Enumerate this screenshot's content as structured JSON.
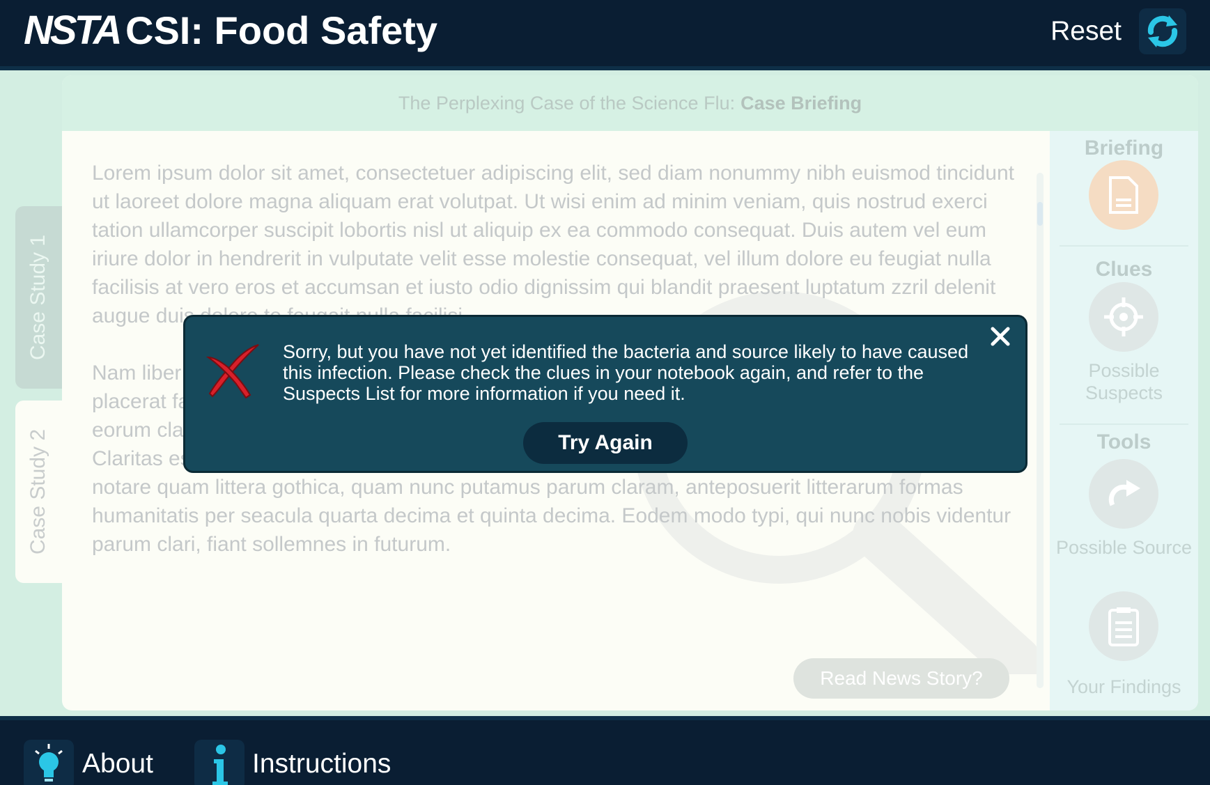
{
  "header": {
    "logo": "NSTA",
    "title": "CSI: Food Safety",
    "reset_label": "Reset"
  },
  "tabs": [
    {
      "label": "Case Study 1"
    },
    {
      "label": "Case Study 2"
    }
  ],
  "panel": {
    "header_prefix": "The Perplexing Case of the Science Flu:",
    "header_bold": "Case Briefing",
    "paragraphs": [
      "Lorem ipsum dolor sit amet, consectetuer adipiscing elit, sed diam nonummy nibh euismod tincidunt ut laoreet dolore magna aliquam erat volutpat. Ut wisi enim ad minim veniam, quis nostrud exerci tation ullamcorper suscipit lobortis nisl ut aliquip ex ea commodo consequat. Duis autem vel eum iriure dolor in hendrerit in vulputate velit esse molestie consequat, vel illum dolore eu feugiat nulla facilisis at vero eros et accumsan et iusto odio dignissim qui blandit praesent luptatum zzril delenit augue duis dolore te feugait nulla facilisi.",
      "Nam liber tempor cum soluta nobis eleifend option congue nihil imperdiet doming id quod mazim placerat facer possim assum. Typi non habent claritatem insitam; est usus legentis in iis qui facit eorum claritatem. Investigationes demonstraverunt lectores legere me lius quod ii legunt saepius. Claritas est etiam processus dynamicus, qui sequitur mutationem consuetudium lectorum. Mirum est notare quam littera gothica, quam nunc putamus parum claram, anteposuerit litterarum formas humanitatis per seacula quarta decima et quinta decima. Eodem modo typi, qui nunc nobis videntur parum clari, fiant sollemnes in futurum."
    ],
    "read_news_label": "Read News Story?"
  },
  "sidenav": {
    "briefing_title": "Briefing",
    "clues_title": "Clues",
    "suspects_label": "Possible Suspects",
    "tools_title": "Tools",
    "source_label": "Possible Source",
    "findings_label": "Your Findings"
  },
  "modal": {
    "message": "Sorry, but you have not yet identified the bacteria and source likely to have caused this infection.  Please check the clues in your notebook again, and refer to the Suspects List for more information if you need it.",
    "button_label": "Try Again"
  },
  "footer": {
    "about_label": "About",
    "instructions_label": "Instructions"
  },
  "colors": {
    "header_bg": "#0a1e33",
    "modal_bg": "#16495b",
    "accent_cyan": "#2bc6e6",
    "error_red": "#d8202a"
  }
}
